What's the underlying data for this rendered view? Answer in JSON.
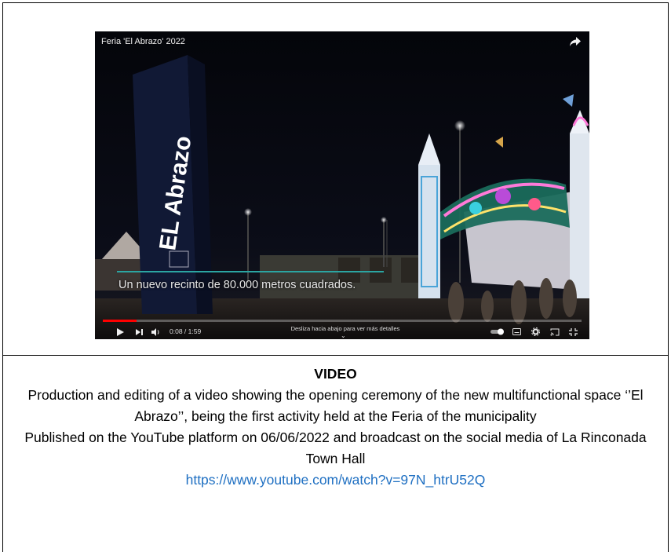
{
  "video": {
    "title": "Feria 'El Abrazo' 2022",
    "subtitle": "Un nuevo recinto de 80.000 metros cuadrados.",
    "tower_text": "EL Abrazo",
    "current_time": "0:08 / 1:59",
    "progress": 0.07,
    "swipe_hint": "Desliza hacia abajo para ver más detalles",
    "icons": [
      "share-icon",
      "play-icon",
      "next-icon",
      "volume-icon",
      "autoplay-toggle-icon",
      "captions-icon",
      "settings-icon",
      "cast-icon",
      "exit-fullscreen-icon"
    ]
  },
  "caption": {
    "heading": "VIDEO",
    "paragraph1": "Production and editing of a video showing the opening ceremony of the new multifunctional space ‘’El Abrazo’’, being the first activity held at the Feria of the municipality",
    "paragraph2": "Published on the YouTube platform on 06/06/2022 and broadcast on the social media of La Rinconada Town Hall",
    "link": "https://www.youtube.com/watch?v=97N_htrU52Q"
  },
  "colors": {
    "link": "#1e6fc2",
    "progress": "#ff0000",
    "subtitle_line": "#2ba5a2"
  }
}
